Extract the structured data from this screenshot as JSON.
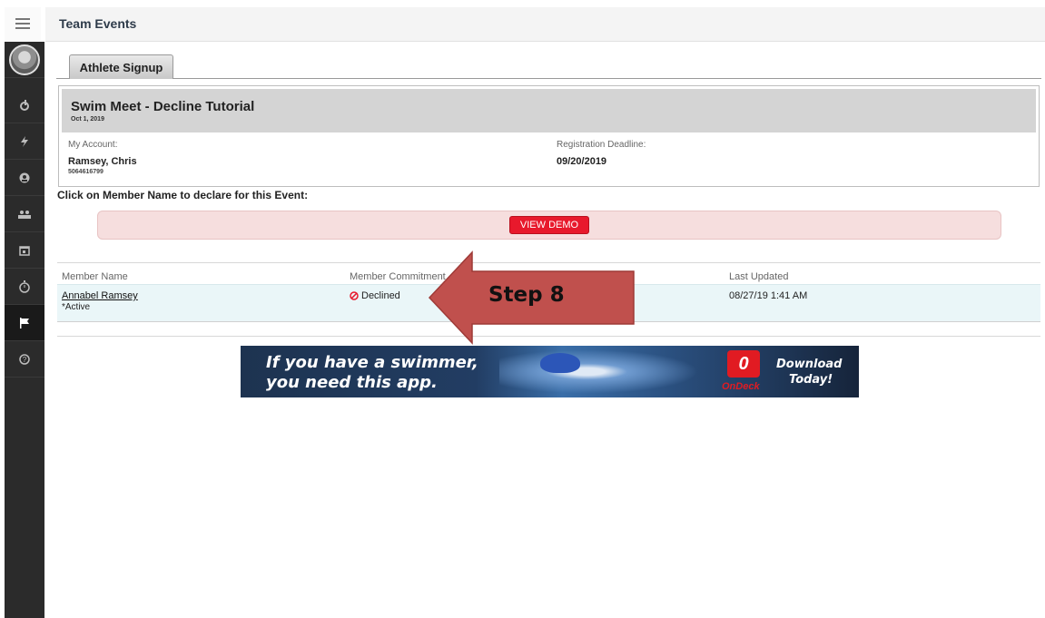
{
  "header": {
    "title": "Team Events"
  },
  "sidebar": {
    "items": [
      {
        "icon": "menu-icon"
      },
      {
        "icon": "avatar"
      },
      {
        "icon": "flame-icon"
      },
      {
        "icon": "bolt-icon"
      },
      {
        "icon": "account-icon"
      },
      {
        "icon": "team-icon"
      },
      {
        "icon": "calendar-icon"
      },
      {
        "icon": "stopwatch-icon"
      },
      {
        "icon": "flag-icon",
        "active": true
      },
      {
        "icon": "help-icon"
      }
    ]
  },
  "tabs": [
    {
      "label": "Athlete Signup",
      "active": true
    }
  ],
  "event": {
    "name": "Swim Meet - Decline Tutorial",
    "date": "Oct 1, 2019",
    "account_label": "My Account:",
    "account_name": "Ramsey, Chris",
    "account_id": "5064616799",
    "deadline_label": "Registration Deadline:",
    "deadline": "09/20/2019"
  },
  "instruction": "Click on Member Name to declare for this Event:",
  "demo_button": "VIEW DEMO",
  "table": {
    "headers": [
      "Member Name",
      "Member Commitment",
      "Last Updated"
    ],
    "rows": [
      {
        "name": "Annabel Ramsey",
        "status": "*Active",
        "commitment": "Declined",
        "updated": "08/27/19 1:41 AM"
      }
    ]
  },
  "annotation": {
    "label": "Step 8",
    "color": "#c0504d"
  },
  "ad": {
    "line1": "If you have a swimmer,",
    "line2": "you need this app.",
    "logo_letter": "0",
    "brand": "OnDeck",
    "cta1": "Download",
    "cta2": "Today!"
  },
  "colors": {
    "accent_red": "#e8192c",
    "demo_bg": "#f6dede",
    "row_bg": "#eaf6f8"
  }
}
